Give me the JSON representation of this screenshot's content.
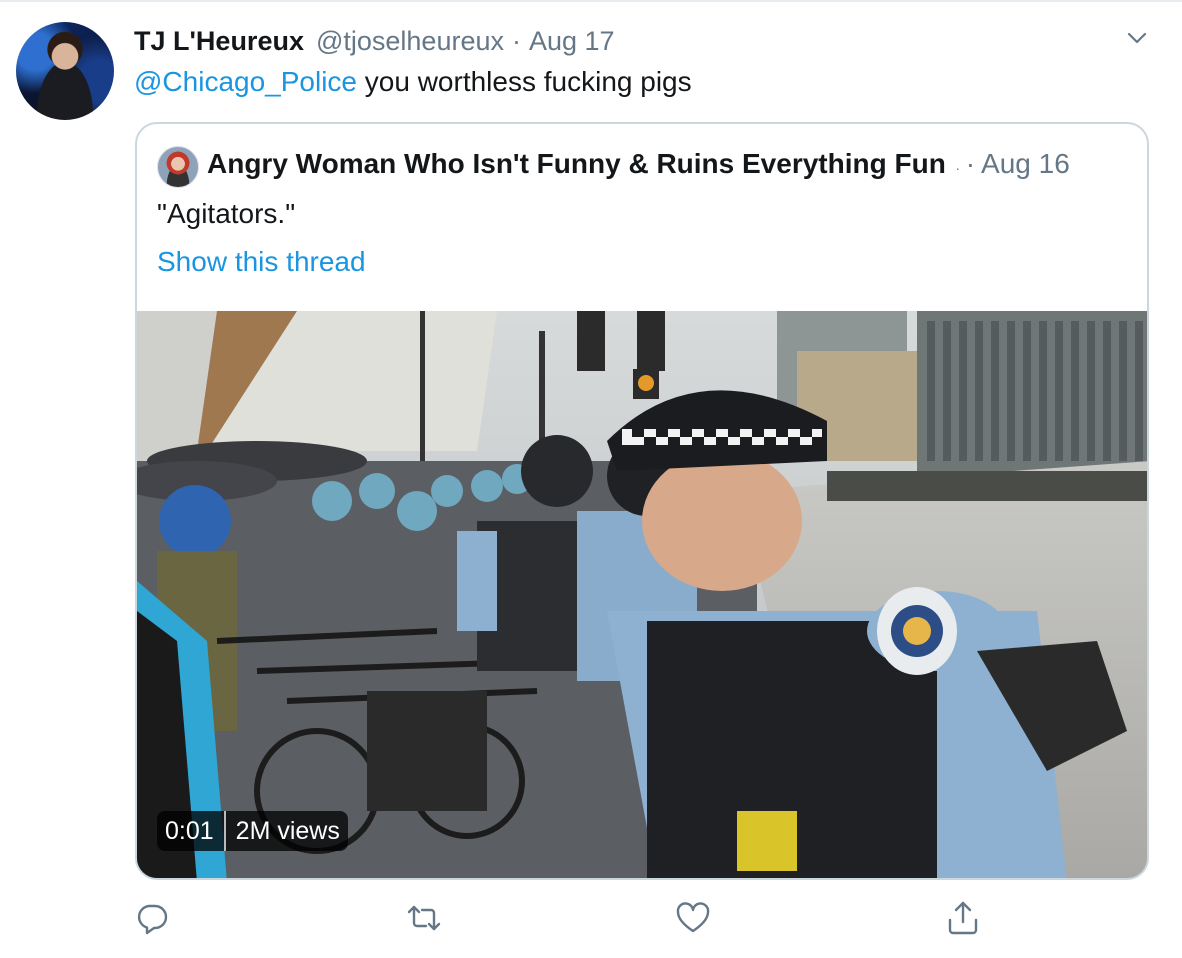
{
  "tweet": {
    "name": "TJ L'Heureux",
    "handle": "@tjoselheureux",
    "separator": "·",
    "date": "Aug 17",
    "mention": "@Chicago_Police",
    "text": " you worthless fucking pigs"
  },
  "quote": {
    "name": "Angry Woman Who Isn't Funny & Ruins Everything Fun",
    "separator": "·",
    "date": "Aug 16",
    "text": "\"Agitators.\"",
    "show_thread": "Show this thread",
    "video": {
      "time": "0:01",
      "views": "2M views"
    }
  },
  "icons": {
    "menu": "chevron-down-icon",
    "reply": "reply-icon",
    "retweet": "retweet-icon",
    "like": "heart-icon",
    "share": "share-icon"
  },
  "colors": {
    "link": "#1b95e0",
    "secondary": "#657786",
    "border": "#ccd6dd"
  }
}
